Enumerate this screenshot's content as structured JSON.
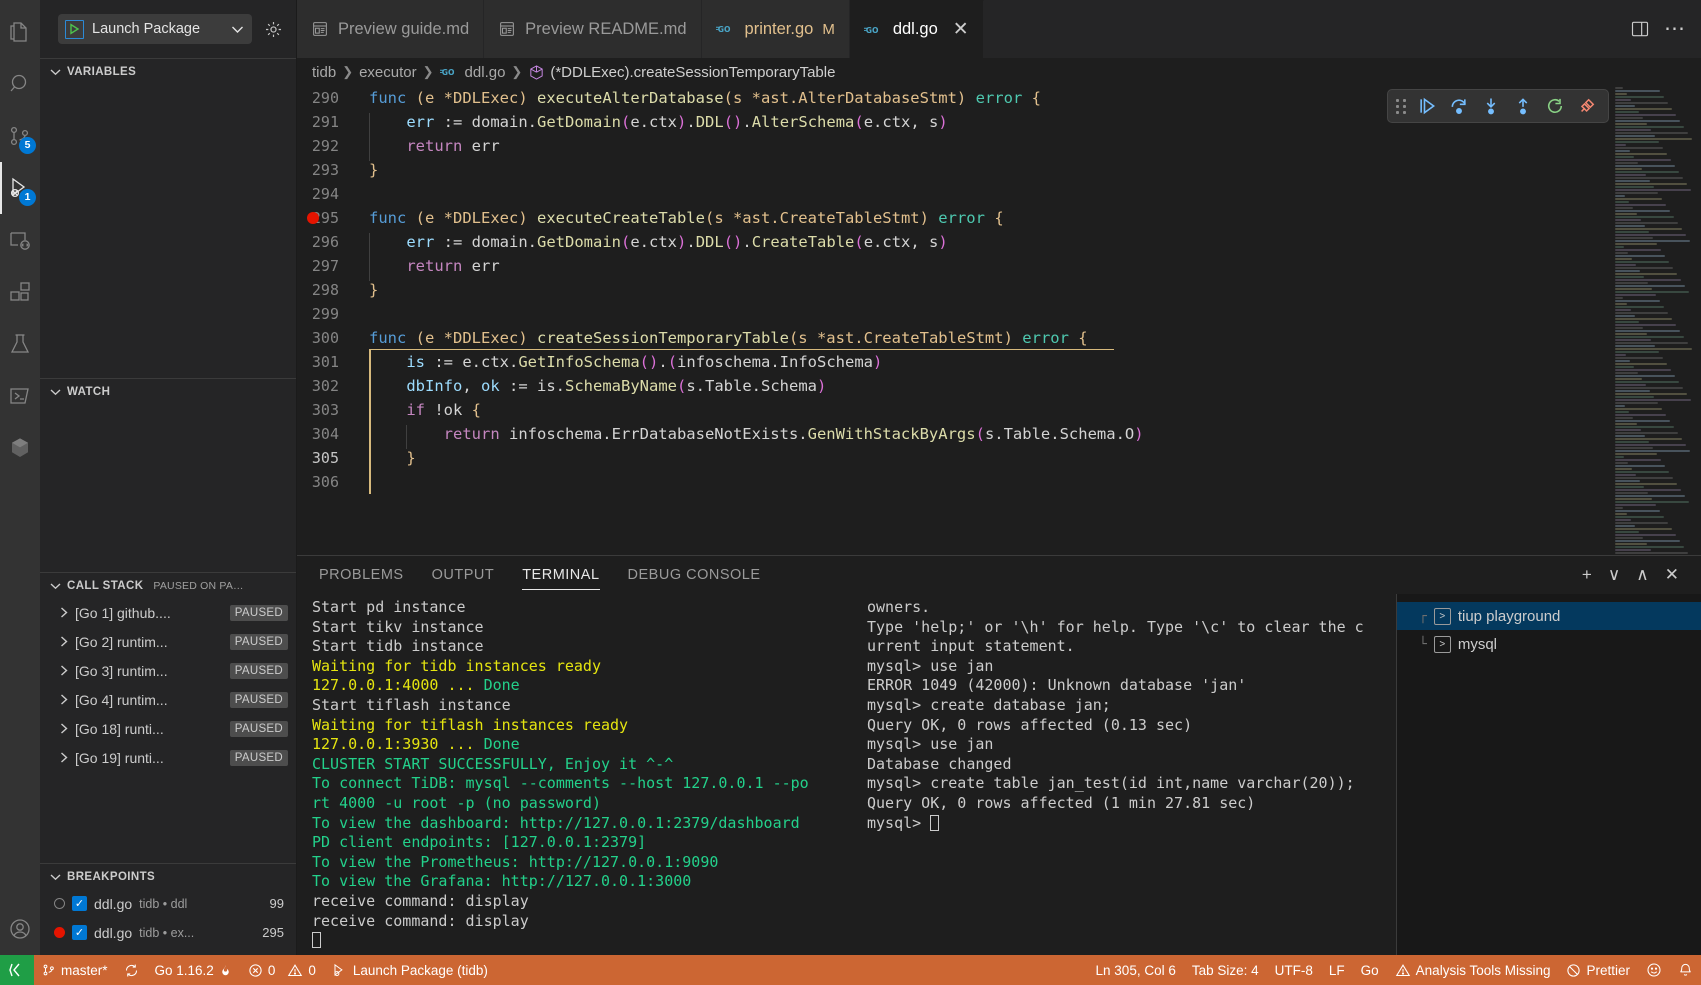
{
  "activitybar": {
    "items": [
      {
        "name": "explorer",
        "icon": "files-icon",
        "badge": null
      },
      {
        "name": "search",
        "icon": "search-icon",
        "badge": null
      },
      {
        "name": "source-control",
        "icon": "source-control-icon",
        "badge": "5"
      },
      {
        "name": "run-and-debug",
        "icon": "run-debug-icon",
        "badge": "1"
      },
      {
        "name": "remote-explorer",
        "icon": "remote-explorer-icon",
        "badge": null
      },
      {
        "name": "extensions",
        "icon": "extensions-icon",
        "badge": null
      },
      {
        "name": "testing",
        "icon": "beaker-icon",
        "badge": null
      },
      {
        "name": "terminal-view",
        "icon": "terminal-icon",
        "badge": null
      },
      {
        "name": "docker",
        "icon": "docker-cube-icon",
        "badge": null
      }
    ],
    "bottom": [
      {
        "name": "accounts",
        "icon": "account-icon"
      },
      {
        "name": "manage",
        "icon": "gear-icon"
      }
    ]
  },
  "sidebar": {
    "launch": {
      "label": "Launch Package",
      "play_icon": "play-icon",
      "chevron": "∨",
      "settings_icon": "gear-icon"
    },
    "panes": {
      "variables": {
        "title": "Variables"
      },
      "watch": {
        "title": "Watch"
      },
      "callstack": {
        "title": "Call Stack",
        "status": "Paused on pa…",
        "rows": [
          {
            "label": "[Go 1] github....",
            "state": "PAUSED"
          },
          {
            "label": "[Go 2] runtim...",
            "state": "PAUSED"
          },
          {
            "label": "[Go 3] runtim...",
            "state": "PAUSED"
          },
          {
            "label": "[Go 4] runtim...",
            "state": "PAUSED"
          },
          {
            "label": "[Go 18] runti...",
            "state": "PAUSED"
          },
          {
            "label": "[Go 19] runti...",
            "state": "PAUSED"
          }
        ]
      },
      "breakpoints": {
        "title": "Breakpoints",
        "rows": [
          {
            "file": "ddl.go",
            "path": "tidb • ddl",
            "line": "99",
            "enabled": true,
            "verified": false
          },
          {
            "file": "ddl.go",
            "path": "tidb • ex...",
            "line": "295",
            "enabled": true,
            "verified": true
          }
        ]
      }
    }
  },
  "tabs": [
    {
      "label": "Preview guide.md",
      "icon": "preview-icon",
      "active": false,
      "modified": false
    },
    {
      "label": "Preview README.md",
      "icon": "preview-icon",
      "active": false,
      "modified": false
    },
    {
      "label": "printer.go",
      "icon": "go-icon",
      "active": false,
      "modified": true,
      "modified_mark": "M"
    },
    {
      "label": "ddl.go",
      "icon": "go-icon",
      "active": true,
      "modified": false,
      "close_icon": "close-icon"
    }
  ],
  "tabbar_actions": [
    {
      "name": "split-editor-icon"
    },
    {
      "name": "more-actions-icon"
    }
  ],
  "breadcrumb": [
    {
      "label": "tidb",
      "icon": null
    },
    {
      "label": "executor",
      "icon": null
    },
    {
      "label": "ddl.go",
      "icon": "go-icon"
    },
    {
      "label": "(*DDLExec).createSessionTemporaryTable",
      "icon": "symbol-method-icon"
    }
  ],
  "debug_toolbar": {
    "buttons": [
      {
        "name": "drag-handle",
        "icon": "grip-icon",
        "color": "#8a8a8a"
      },
      {
        "name": "continue-button",
        "icon": "continue-icon",
        "color": "#75beff"
      },
      {
        "name": "step-over-button",
        "icon": "step-over-icon",
        "color": "#75beff"
      },
      {
        "name": "step-into-button",
        "icon": "step-into-icon",
        "color": "#75beff"
      },
      {
        "name": "step-out-button",
        "icon": "step-out-icon",
        "color": "#75beff"
      },
      {
        "name": "restart-button",
        "icon": "restart-icon",
        "color": "#89d185"
      },
      {
        "name": "disconnect-button",
        "icon": "disconnect-icon",
        "color": "#f48771"
      }
    ]
  },
  "editor": {
    "first_line": 290,
    "breakpoint_line": 295,
    "current_highlight_start": 300,
    "lines": [
      {
        "n": 290,
        "tokens": [
          {
            "t": "func",
            "c": "kw"
          },
          {
            "t": " ",
            "c": "plain"
          },
          {
            "t": "(e *DDLExec)",
            "c": "paren-y"
          },
          {
            "t": " ",
            "c": "plain"
          },
          {
            "t": "executeAlterDatabase",
            "c": "fn"
          },
          {
            "t": "(s *ast.AlterDatabaseStmt)",
            "c": "paren-y"
          },
          {
            "t": " ",
            "c": "plain"
          },
          {
            "t": "error",
            "c": "type"
          },
          {
            "t": " ",
            "c": "plain"
          },
          {
            "t": "{",
            "c": "paren-y"
          }
        ]
      },
      {
        "n": 291,
        "indent": 1,
        "tokens": [
          {
            "t": "    ",
            "c": "plain"
          },
          {
            "t": "err",
            "c": "var"
          },
          {
            "t": " := ",
            "c": "plain"
          },
          {
            "t": "domain",
            "c": "plain"
          },
          {
            "t": ".",
            "c": "plain"
          },
          {
            "t": "GetDomain",
            "c": "fn"
          },
          {
            "t": "(",
            "c": "paren-p"
          },
          {
            "t": "e.ctx",
            "c": "plain"
          },
          {
            "t": ")",
            "c": "paren-p"
          },
          {
            "t": ".",
            "c": "plain"
          },
          {
            "t": "DDL",
            "c": "fn"
          },
          {
            "t": "()",
            "c": "paren-p"
          },
          {
            "t": ".",
            "c": "plain"
          },
          {
            "t": "AlterSchema",
            "c": "fn"
          },
          {
            "t": "(",
            "c": "paren-p"
          },
          {
            "t": "e.ctx, s",
            "c": "plain"
          },
          {
            "t": ")",
            "c": "paren-p"
          }
        ]
      },
      {
        "n": 292,
        "indent": 1,
        "tokens": [
          {
            "t": "    ",
            "c": "plain"
          },
          {
            "t": "return",
            "c": "ctrl"
          },
          {
            "t": " err",
            "c": "plain"
          }
        ]
      },
      {
        "n": 293,
        "tokens": [
          {
            "t": "}",
            "c": "paren-y"
          }
        ]
      },
      {
        "n": 294,
        "tokens": []
      },
      {
        "n": 295,
        "breakpoint": true,
        "tokens": [
          {
            "t": "func",
            "c": "kw"
          },
          {
            "t": " ",
            "c": "plain"
          },
          {
            "t": "(e *DDLExec)",
            "c": "paren-y"
          },
          {
            "t": " ",
            "c": "plain"
          },
          {
            "t": "executeCreateTable",
            "c": "fn"
          },
          {
            "t": "(s *ast.CreateTableStmt)",
            "c": "paren-y"
          },
          {
            "t": " ",
            "c": "plain"
          },
          {
            "t": "error",
            "c": "type"
          },
          {
            "t": " ",
            "c": "plain"
          },
          {
            "t": "{",
            "c": "paren-y"
          }
        ]
      },
      {
        "n": 296,
        "indent": 1,
        "tokens": [
          {
            "t": "    ",
            "c": "plain"
          },
          {
            "t": "err",
            "c": "var"
          },
          {
            "t": " := ",
            "c": "plain"
          },
          {
            "t": "domain",
            "c": "plain"
          },
          {
            "t": ".",
            "c": "plain"
          },
          {
            "t": "GetDomain",
            "c": "fn"
          },
          {
            "t": "(",
            "c": "paren-p"
          },
          {
            "t": "e.ctx",
            "c": "plain"
          },
          {
            "t": ")",
            "c": "paren-p"
          },
          {
            "t": ".",
            "c": "plain"
          },
          {
            "t": "DDL",
            "c": "fn"
          },
          {
            "t": "()",
            "c": "paren-p"
          },
          {
            "t": ".",
            "c": "plain"
          },
          {
            "t": "CreateTable",
            "c": "fn"
          },
          {
            "t": "(",
            "c": "paren-p"
          },
          {
            "t": "e.ctx, s",
            "c": "plain"
          },
          {
            "t": ")",
            "c": "paren-p"
          }
        ]
      },
      {
        "n": 297,
        "indent": 1,
        "tokens": [
          {
            "t": "    ",
            "c": "plain"
          },
          {
            "t": "return",
            "c": "ctrl"
          },
          {
            "t": " err",
            "c": "plain"
          }
        ]
      },
      {
        "n": 298,
        "tokens": [
          {
            "t": "}",
            "c": "paren-y"
          }
        ]
      },
      {
        "n": 299,
        "tokens": []
      },
      {
        "n": 300,
        "tokens": [
          {
            "t": "func",
            "c": "kw"
          },
          {
            "t": " ",
            "c": "plain"
          },
          {
            "t": "(e *DDLExec)",
            "c": "paren-y"
          },
          {
            "t": " ",
            "c": "plain"
          },
          {
            "t": "createSessionTemporaryTable",
            "c": "fn"
          },
          {
            "t": "(s *ast.CreateTableStmt)",
            "c": "paren-y"
          },
          {
            "t": " ",
            "c": "plain"
          },
          {
            "t": "error",
            "c": "type"
          },
          {
            "t": " ",
            "c": "plain"
          },
          {
            "t": "{",
            "c": "paren-y"
          }
        ]
      },
      {
        "n": 301,
        "indent": 1,
        "tokens": [
          {
            "t": "    ",
            "c": "plain"
          },
          {
            "t": "is",
            "c": "var"
          },
          {
            "t": " := ",
            "c": "plain"
          },
          {
            "t": "e.ctx",
            "c": "plain"
          },
          {
            "t": ".",
            "c": "plain"
          },
          {
            "t": "GetInfoSchema",
            "c": "fn"
          },
          {
            "t": "()",
            "c": "paren-p"
          },
          {
            "t": ".",
            "c": "plain"
          },
          {
            "t": "(",
            "c": "paren-p"
          },
          {
            "t": "infoschema.InfoSchema",
            "c": "plain"
          },
          {
            "t": ")",
            "c": "paren-p"
          }
        ]
      },
      {
        "n": 302,
        "indent": 1,
        "tokens": [
          {
            "t": "    ",
            "c": "plain"
          },
          {
            "t": "dbInfo",
            "c": "var"
          },
          {
            "t": ", ",
            "c": "plain"
          },
          {
            "t": "ok",
            "c": "var"
          },
          {
            "t": " := ",
            "c": "plain"
          },
          {
            "t": "is",
            "c": "plain"
          },
          {
            "t": ".",
            "c": "plain"
          },
          {
            "t": "SchemaByName",
            "c": "fn"
          },
          {
            "t": "(",
            "c": "paren-p"
          },
          {
            "t": "s.Table.Schema",
            "c": "plain"
          },
          {
            "t": ")",
            "c": "paren-p"
          }
        ]
      },
      {
        "n": 303,
        "indent": 1,
        "tokens": [
          {
            "t": "    ",
            "c": "plain"
          },
          {
            "t": "if",
            "c": "ctrl"
          },
          {
            "t": " !ok ",
            "c": "plain"
          },
          {
            "t": "{",
            "c": "paren-y"
          }
        ]
      },
      {
        "n": 304,
        "indent": 2,
        "tokens": [
          {
            "t": "        ",
            "c": "plain"
          },
          {
            "t": "return",
            "c": "ctrl"
          },
          {
            "t": " infoschema.ErrDatabaseNotExists.",
            "c": "plain"
          },
          {
            "t": "GenWithStackByArgs",
            "c": "fn"
          },
          {
            "t": "(",
            "c": "paren-p"
          },
          {
            "t": "s.Table.Schema.O",
            "c": "plain"
          },
          {
            "t": ")",
            "c": "paren-p"
          }
        ]
      },
      {
        "n": 305,
        "indent": 1,
        "current": true,
        "tokens": [
          {
            "t": "    ",
            "c": "plain"
          },
          {
            "t": "}",
            "c": "paren-y"
          }
        ]
      },
      {
        "n": 306,
        "tokens": []
      }
    ]
  },
  "panel": {
    "tabs": [
      {
        "label": "PROBLEMS",
        "active": false
      },
      {
        "label": "OUTPUT",
        "active": false
      },
      {
        "label": "TERMINAL",
        "active": true
      },
      {
        "label": "DEBUG CONSOLE",
        "active": false
      }
    ],
    "actions": [
      {
        "name": "new-terminal-icon",
        "glyph": "+"
      },
      {
        "name": "terminal-dropdown-icon",
        "glyph": "∨"
      },
      {
        "name": "maximize-panel-icon",
        "glyph": "∧"
      },
      {
        "name": "close-panel-icon",
        "glyph": "✕"
      }
    ],
    "terminal_left": [
      {
        "text": "Start pd instance",
        "color": "white"
      },
      {
        "text": "Start tikv instance",
        "color": "white"
      },
      {
        "text": "Start tidb instance",
        "color": "white"
      },
      {
        "text": "Waiting for tidb instances ready",
        "color": "yellow"
      },
      {
        "text": "127.0.0.1:4000 ... ",
        "color": "yellow",
        "tail": "Done",
        "tail_color": "green"
      },
      {
        "text": "Start tiflash instance",
        "color": "white"
      },
      {
        "text": "Waiting for tiflash instances ready",
        "color": "yellow"
      },
      {
        "text": "127.0.0.1:3930 ... ",
        "color": "yellow",
        "tail": "Done",
        "tail_color": "green"
      },
      {
        "text": "CLUSTER START SUCCESSFULLY, Enjoy it ^-^",
        "color": "green"
      },
      {
        "text": "To connect TiDB: mysql --comments --host 127.0.0.1 --po",
        "color": "green"
      },
      {
        "text": "rt 4000 -u root -p (no password)",
        "color": "green"
      },
      {
        "text": "To view the dashboard: http://127.0.0.1:2379/dashboard",
        "color": "green"
      },
      {
        "text": "PD client endpoints: [127.0.0.1:2379]",
        "color": "green"
      },
      {
        "text": "To view the Prometheus: http://127.0.0.1:9090",
        "color": "green"
      },
      {
        "text": "To view the Grafana: http://127.0.0.1:3000",
        "color": "green"
      },
      {
        "text": "receive command: display",
        "color": "white"
      },
      {
        "text": "receive command: display",
        "color": "white"
      },
      {
        "text": "",
        "color": "white",
        "cursor": true
      }
    ],
    "terminal_right": [
      {
        "text": "owners.",
        "color": "white"
      },
      {
        "text": "",
        "color": "white"
      },
      {
        "text": "Type 'help;' or '\\h' for help. Type '\\c' to clear the c",
        "color": "white"
      },
      {
        "text": "urrent input statement.",
        "color": "white"
      },
      {
        "text": "",
        "color": "white"
      },
      {
        "text": "mysql> use jan",
        "color": "white"
      },
      {
        "text": "ERROR 1049 (42000): Unknown database 'jan'",
        "color": "white"
      },
      {
        "text": "mysql> create database jan;",
        "color": "white"
      },
      {
        "text": "Query OK, 0 rows affected (0.13 sec)",
        "color": "white"
      },
      {
        "text": "",
        "color": "white"
      },
      {
        "text": "mysql> use jan",
        "color": "white"
      },
      {
        "text": "Database changed",
        "color": "white"
      },
      {
        "text": "mysql> create table jan_test(id int,name varchar(20));",
        "color": "white"
      },
      {
        "text": "",
        "color": "white"
      },
      {
        "text": "Query OK, 0 rows affected (1 min 27.81 sec)",
        "color": "white"
      },
      {
        "text": "",
        "color": "white"
      },
      {
        "text": "mysql> ",
        "color": "white",
        "cursor": true
      }
    ],
    "terminal_list": [
      {
        "label": "tiup playground",
        "active": true,
        "tree": "┌"
      },
      {
        "label": "mysql",
        "active": false,
        "tree": "└"
      }
    ]
  },
  "statusbar": {
    "remote_icon": "remote-indicator-icon",
    "left": [
      {
        "name": "branch",
        "icon": "source-control-icon",
        "label": "master*"
      },
      {
        "name": "sync",
        "icon": "sync-icon",
        "label": ""
      },
      {
        "name": "go-version",
        "icon": "",
        "label": "Go 1.16.2"
      },
      {
        "name": "go-env",
        "icon": "flame-icon",
        "label": ""
      },
      {
        "name": "problems",
        "icon": "error-warning-icon",
        "label": "0",
        "warn_label": "0"
      },
      {
        "name": "launch-debug",
        "icon": "debug-start-icon",
        "label": "Launch Package (tidb)"
      }
    ],
    "right": [
      {
        "name": "cursor-position",
        "label": "Ln 305, Col 6"
      },
      {
        "name": "indentation",
        "label": "Tab Size: 4"
      },
      {
        "name": "encoding",
        "label": "UTF-8"
      },
      {
        "name": "eol",
        "label": "LF"
      },
      {
        "name": "language-mode",
        "label": "Go"
      },
      {
        "name": "analysis-tools",
        "icon": "warning-icon",
        "label": "Analysis Tools Missing"
      },
      {
        "name": "prettier",
        "icon": "prohibited-icon",
        "label": "Prettier"
      },
      {
        "name": "notifications",
        "icon": "bell-icon",
        "label": ""
      }
    ]
  },
  "colors": {
    "statusbar_debug": "#cc6633",
    "accent_blue": "#0078d4",
    "breakpoint_red": "#e51400",
    "remote_green": "#1f9e46"
  }
}
